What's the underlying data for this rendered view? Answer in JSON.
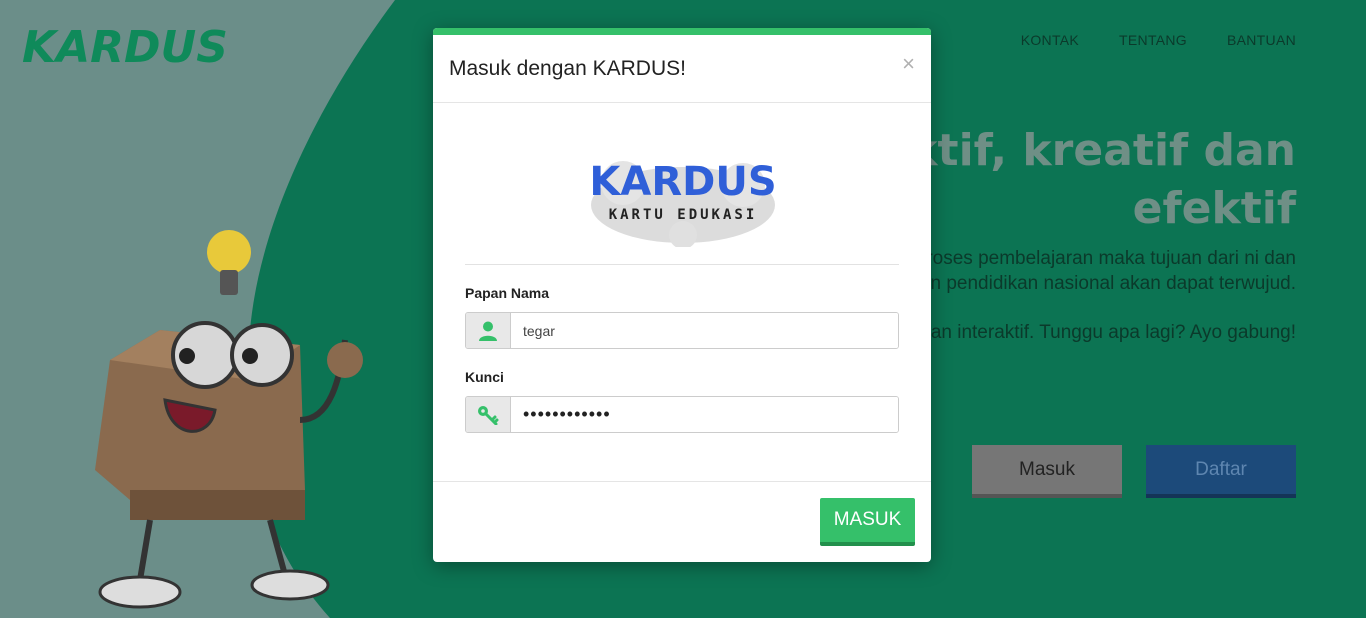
{
  "background": {
    "logo_text": "KARDUS!",
    "nav": [
      {
        "label": "KONTAK"
      },
      {
        "label": "TENTANG"
      },
      {
        "label": "BANTUAN"
      }
    ],
    "hero_title_line1": "aktif, kreatif dan",
    "hero_title_line2": "efektif",
    "hero_text_1": "proses pembelajaran maka tujuan dari ni dan tujuan pendidikan nasional akan dapat terwujud.",
    "hero_text_2": "ik dan interaktif. Tunggu apa lagi? Ayo gabung!",
    "btn_masuk": "Masuk",
    "btn_daftar": "Daftar"
  },
  "modal": {
    "title": "Masuk dengan KARDUS!",
    "close": "×",
    "brand_title": "KARDUS",
    "brand_subtitle": "KARTU EDUKASI",
    "username_label": "Papan Nama",
    "username_value": "tegar",
    "password_label": "Kunci",
    "password_value": "••••••••••••",
    "submit": "MASUK"
  },
  "colors": {
    "accent": "#35c06a",
    "bg_green": "#0c7453",
    "daftar_blue": "#1c4a7a"
  },
  "icons": {
    "username": "user-icon",
    "password": "key-icon",
    "close": "close-icon"
  }
}
